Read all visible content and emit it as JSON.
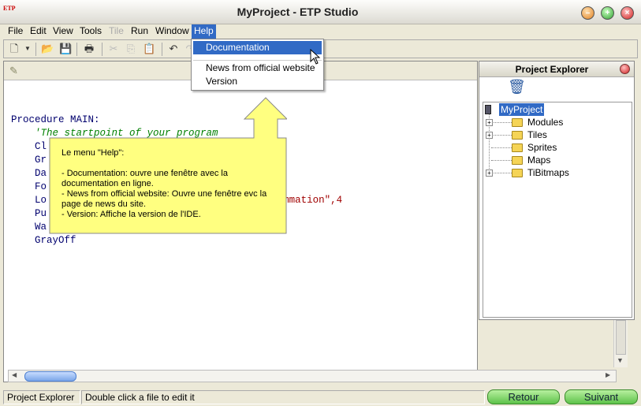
{
  "window": {
    "title": "MyProject - ETP Studio",
    "icon_text": "ETP"
  },
  "menubar": {
    "items": [
      {
        "label": "File",
        "disabled": false
      },
      {
        "label": "Edit",
        "disabled": false
      },
      {
        "label": "View",
        "disabled": false
      },
      {
        "label": "Tools",
        "disabled": false
      },
      {
        "label": "Tile",
        "disabled": true
      },
      {
        "label": "Run",
        "disabled": false
      },
      {
        "label": "Window",
        "disabled": false
      },
      {
        "label": "Help",
        "disabled": false,
        "active": true
      }
    ]
  },
  "help_menu": {
    "items": [
      {
        "label": "Documentation",
        "highlighted": true
      },
      {
        "label": "News from official website",
        "highlighted": false
      },
      {
        "label": "Version",
        "highlighted": false
      }
    ]
  },
  "editor": {
    "lines": [
      {
        "segments": [
          {
            "text": "Procedure MAIN:",
            "kind": "kw"
          }
        ]
      },
      {
        "segments": [
          {
            "text": "    'The startpoint of your program",
            "kind": "cm"
          }
        ]
      },
      {
        "segments": [
          {
            "text": "    Cl",
            "kind": "kw"
          }
        ]
      },
      {
        "segments": [
          {
            "text": "    Gr",
            "kind": "kw"
          }
        ]
      },
      {
        "segments": [
          {
            "text": "    Da",
            "kind": "kw"
          }
        ]
      },
      {
        "segments": [
          {
            "text": "    Fo",
            "kind": "kw"
          }
        ]
      },
      {
        "segments": [
          {
            "text": "    Lo",
            "kind": "kw"
          },
          {
            "text": "                                    ogrammation\"",
            "kind": "st"
          },
          {
            "text": ",4",
            "kind": "st"
          }
        ]
      },
      {
        "segments": [
          {
            "text": "    Pu",
            "kind": "kw"
          }
        ]
      },
      {
        "segments": [
          {
            "text": "    Wa",
            "kind": "kw"
          }
        ]
      },
      {
        "segments": [
          {
            "text": "    GrayOff",
            "kind": "kw"
          }
        ]
      }
    ]
  },
  "explorer": {
    "title": "Project Explorer",
    "root": "MyProject",
    "items": [
      {
        "label": "Modules",
        "expandable": true
      },
      {
        "label": "Tiles",
        "expandable": true
      },
      {
        "label": "Sprites",
        "expandable": false
      },
      {
        "label": "Maps",
        "expandable": false
      },
      {
        "label": "TiBitmaps",
        "expandable": true
      }
    ]
  },
  "callout": {
    "lines": [
      "Le menu \"Help\":",
      "",
      "- Documentation: ouvre une fenêtre avec la documentation en ligne.",
      "- News from official website: Ouvre une fenêtre evc la page de news du site.",
      "- Version: Affiche la version de l'IDE."
    ]
  },
  "statusbar": {
    "left": "Project Explorer",
    "right": "Double click a file to edit it"
  },
  "nav": {
    "back": "Retour",
    "next": "Suivant"
  },
  "colors": {
    "menu_highlight": "#316ac5",
    "callout_fill": "#ffff80",
    "nav_button": "#5ec24a"
  }
}
